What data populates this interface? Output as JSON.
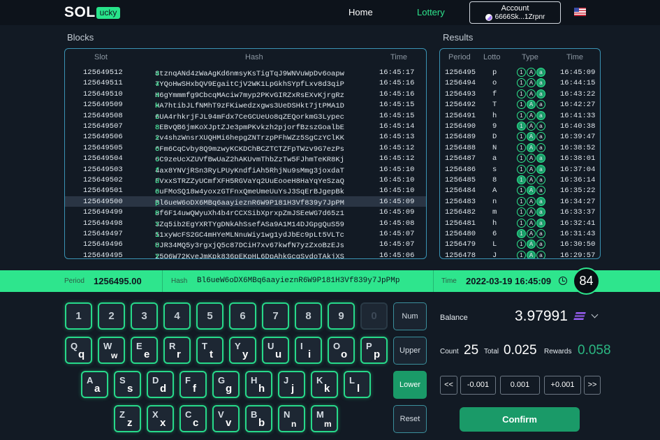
{
  "nav": {
    "logo_main": "SOL",
    "logo_badge": "ucky",
    "home": "Home",
    "lottery": "Lottery",
    "account_title": "Account",
    "account_addr": "6666Sk...1Zrpnr",
    "language_flag": "us-flag"
  },
  "blocks": {
    "title": "Blocks",
    "headers": {
      "slot": "Slot",
      "hash": "Hash",
      "time": "Time"
    },
    "rows": [
      {
        "slot": "125649512",
        "hash": "8tznqANd4zWaAgKd6nmsyKsTigTqJ9WNVuWpDv6oapw",
        "last": "4",
        "time": "16:45:17"
      },
      {
        "slot": "125649511",
        "hash": "7YQoHwSHxbQV9EgaitCjV2WK1LpGkhSYpfLxv8d3qiP",
        "last": "4",
        "time": "16:45:16"
      },
      {
        "slot": "125649510",
        "hash": "H6gYmmmfg9CbcqMAciw7myp2PKvGIRZxRsEXvKjrgRz",
        "last": "4",
        "time": "16:45:16"
      },
      {
        "slot": "125649509",
        "hash": "HA7htibJLfNMhT9zFKiwedzxgws3UeDSHkt7jtPMA1D",
        "last": "k",
        "time": "16:45:15"
      },
      {
        "slot": "125649508",
        "hash": "6UA4rhkrjFJL94mFdx7CeGCUeUo8qZEQorkmG3Lypec",
        "last": "z",
        "time": "16:45:15"
      },
      {
        "slot": "125649507",
        "hash": "8EBvQB6jmKoXJptZJe3pmPKvkzh2pjorfBzszGoalbE",
        "last": "8",
        "time": "16:45:14"
      },
      {
        "slot": "125649506",
        "hash": "2v4shzWnsrXUQHMi6hepgZNTrzpPFhWZz5SgCzYClKK",
        "last": "x",
        "time": "16:45:13"
      },
      {
        "slot": "125649505",
        "hash": "6Fm6CqCvby8Q9mzwyKCKDChBCZTCTZFpTWzv9G7ezPs",
        "last": "o",
        "time": "16:45:12"
      },
      {
        "slot": "125649504",
        "hash": "6C9zeUcXZUVfBwUaZ2hAKUvmThbZzTw5FJhmTeKR8Kj",
        "last": "J",
        "time": "16:45:12"
      },
      {
        "slot": "125649503",
        "hash": "4ax8YNVjRSn3RyLPUyKndfiAh5RhjNu9sMmg3joxdaT",
        "last": "f",
        "time": "16:45:10"
      },
      {
        "slot": "125649502",
        "hash": "FVxxSTRZZyUCmfXFH5RGVaYq2UuEooeH8HaYqYeSzaQ",
        "last": "d",
        "time": "16:45:10"
      },
      {
        "slot": "125649501",
        "hash": "6uFMoSQ18w4yoxzGTFnxQmeUmeUuYsJ3SqErBJgepBk",
        "last": "8",
        "time": "16:45:10"
      },
      {
        "slot": "125649500",
        "hash": "Bl6ueW6oDX6MBq6aayieznR6W9P181H3Vf839y7JpPM",
        "last": "p",
        "time": "16:45:09",
        "selected": true
      },
      {
        "slot": "125649499",
        "hash": "8f6F14uwQWyuXh4b4rCCXSibXprxpZmJSEeWG7d65z1",
        "last": "P",
        "time": "16:45:09"
      },
      {
        "slot": "125649498",
        "hash": "3Zq5ib2EgYXRTYgDNkAhSsefASa9A1M14DJGpgQuS59",
        "last": "Y",
        "time": "16:45:08"
      },
      {
        "slot": "125649497",
        "hash": "51xyWcFS2GC4mHYeMLNnuWiy1wg1ydJbEc9pLt5VLTc",
        "last": "1",
        "time": "16:45:07"
      },
      {
        "slot": "125649496",
        "hash": "8JR34MQ5y3rgxjQ5c87DCiH7xv67kwfN7yzZxoBzEJs",
        "last": "U",
        "time": "16:45:07"
      },
      {
        "slot": "125649495",
        "hash": "25Q6W72KyeJmKpk836pEKpHL6DpAhkGcgSvdoTAkjXS",
        "last": "Y",
        "time": "16:45:06"
      }
    ]
  },
  "results": {
    "title": "Results",
    "headers": {
      "period": "Period",
      "lotto": "Lotto",
      "type": "Type",
      "time": "Time"
    },
    "rows": [
      {
        "period": "1256495",
        "lotto": "p",
        "type": [
          false,
          false,
          true
        ],
        "time": "16:45:09"
      },
      {
        "period": "1256494",
        "lotto": "o",
        "type": [
          false,
          false,
          true
        ],
        "time": "16:44:15"
      },
      {
        "period": "1256493",
        "lotto": "f",
        "type": [
          false,
          false,
          true
        ],
        "time": "16:43:22"
      },
      {
        "period": "1256492",
        "lotto": "T",
        "type": [
          false,
          true,
          false
        ],
        "time": "16:42:27"
      },
      {
        "period": "1256491",
        "lotto": "h",
        "type": [
          false,
          false,
          true
        ],
        "time": "16:41:33"
      },
      {
        "period": "1256490",
        "lotto": "9",
        "type": [
          true,
          false,
          false
        ],
        "time": "16:40:38"
      },
      {
        "period": "1256489",
        "lotto": "D",
        "type": [
          false,
          true,
          false
        ],
        "time": "16:39:47"
      },
      {
        "period": "1256488",
        "lotto": "N",
        "type": [
          false,
          true,
          false
        ],
        "time": "16:38:52"
      },
      {
        "period": "1256487",
        "lotto": "a",
        "type": [
          false,
          false,
          true
        ],
        "time": "16:38:01"
      },
      {
        "period": "1256486",
        "lotto": "s",
        "type": [
          false,
          false,
          true
        ],
        "time": "16:37:04"
      },
      {
        "period": "1256485",
        "lotto": "8",
        "type": [
          true,
          false,
          false
        ],
        "time": "16:36:14"
      },
      {
        "period": "1256484",
        "lotto": "A",
        "type": [
          false,
          true,
          false
        ],
        "time": "16:35:22"
      },
      {
        "period": "1256483",
        "lotto": "n",
        "type": [
          false,
          false,
          true
        ],
        "time": "16:34:27"
      },
      {
        "period": "1256482",
        "lotto": "m",
        "type": [
          false,
          false,
          true
        ],
        "time": "16:33:37"
      },
      {
        "period": "1256481",
        "lotto": "h",
        "type": [
          false,
          false,
          true
        ],
        "time": "16:32:41"
      },
      {
        "period": "1256480",
        "lotto": "6",
        "type": [
          true,
          false,
          false
        ],
        "time": "16:31:43"
      },
      {
        "period": "1256479",
        "lotto": "L",
        "type": [
          false,
          true,
          false
        ],
        "time": "16:30:50"
      },
      {
        "period": "1256478",
        "lotto": "J",
        "type": [
          false,
          true,
          false
        ],
        "time": "16:29:57"
      }
    ]
  },
  "infobar": {
    "period_label": "Period",
    "period_value": "1256495.00",
    "hash_label": "Hash",
    "hash_value": "Bl6ueW6oDX6MBq6aayieznR6W9P181H3Vf839y7JpPMp",
    "time_label": "Time",
    "time_value": "2022-03-19 16:45:09",
    "countdown": "84"
  },
  "keyboard": {
    "numbers": [
      "1",
      "2",
      "3",
      "4",
      "5",
      "6",
      "7",
      "8",
      "9",
      "0"
    ],
    "disabled_numbers": [
      "0"
    ],
    "row1": [
      [
        "Q",
        "q"
      ],
      [
        "W",
        "w"
      ],
      [
        "E",
        "e"
      ],
      [
        "R",
        "r"
      ],
      [
        "T",
        "t"
      ],
      [
        "Y",
        "y"
      ],
      [
        "U",
        "u"
      ],
      [
        "I",
        "i"
      ],
      [
        "O",
        "o"
      ],
      [
        "P",
        "p"
      ]
    ],
    "row2": [
      [
        "A",
        "a"
      ],
      [
        "S",
        "s"
      ],
      [
        "D",
        "d"
      ],
      [
        "F",
        "f"
      ],
      [
        "G",
        "g"
      ],
      [
        "H",
        "h"
      ],
      [
        "J",
        "j"
      ],
      [
        "K",
        "k"
      ],
      [
        "L",
        "l"
      ]
    ],
    "row3": [
      [
        "Z",
        "z"
      ],
      [
        "X",
        "x"
      ],
      [
        "C",
        "c"
      ],
      [
        "V",
        "v"
      ],
      [
        "B",
        "b"
      ],
      [
        "N",
        "n"
      ],
      [
        "M",
        "m"
      ]
    ],
    "disabled_letters": [
      "I",
      "O",
      "l"
    ],
    "mode_num": "Num",
    "mode_upper": "Upper",
    "mode_lower": "Lower",
    "reset": "Reset",
    "active_mode": "Lower"
  },
  "wallet": {
    "balance_label": "Balance",
    "balance_value": "3.97991",
    "token_icon": "solana-icon",
    "count_label": "Count",
    "count_value": "25",
    "total_label": "Total",
    "total_value": "0.025",
    "rewards_label": "Rewards",
    "rewards_value": "0.058",
    "step_prev": "<<",
    "step_minus": "-0.001",
    "step_value": "0.001",
    "step_plus": "+0.001",
    "step_next": ">>",
    "confirm": "Confirm"
  },
  "colors": {
    "accent": "#2ee58d",
    "accent_dark": "#1a9a68",
    "background": "#121a24",
    "panel_border": "#3a93b4"
  }
}
